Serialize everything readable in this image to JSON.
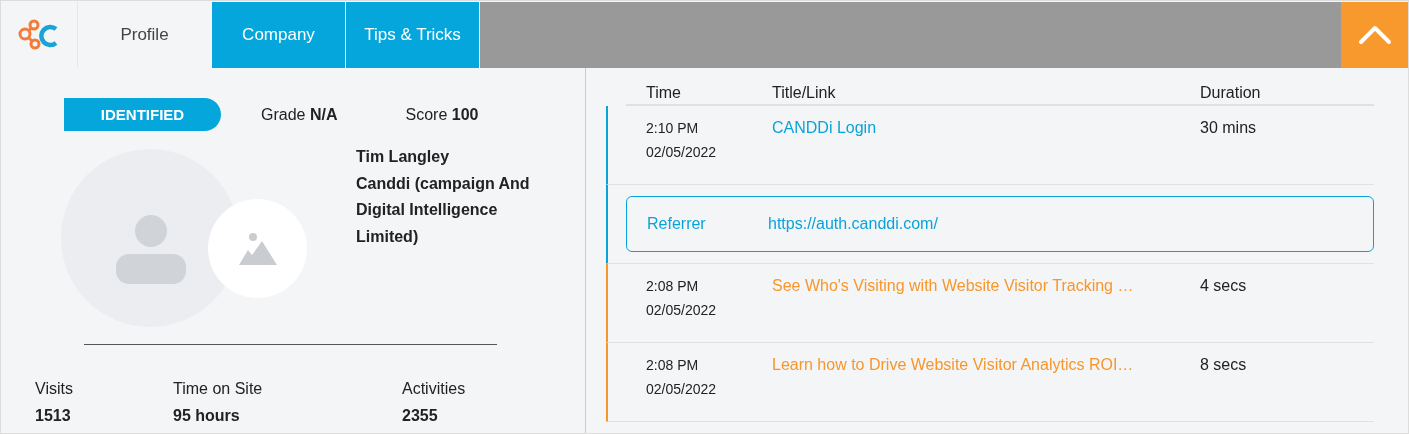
{
  "tabs": [
    {
      "label": "Profile",
      "selected": true
    },
    {
      "label": "Company",
      "selected": false
    },
    {
      "label": "Tips & Tricks",
      "selected": false
    }
  ],
  "profile": {
    "status": "IDENTIFIED",
    "grade_label": "Grade",
    "grade": "N/A",
    "score_label": "Score",
    "score": "100",
    "name": "Tim Langley",
    "company": "Canddi (campaign And Digital Intelligence Limited)"
  },
  "stats": [
    {
      "label": "Visits",
      "value": "1513"
    },
    {
      "label": "Time on Site",
      "value": "95 hours"
    },
    {
      "label": "Activities",
      "value": "2355"
    }
  ],
  "activity": {
    "columns": [
      "Time",
      "Title/Link",
      "Duration"
    ],
    "rows": [
      {
        "kind": "visit",
        "time": "2:10 PM",
        "date": "02/05/2022",
        "title": "CANDDi Login",
        "duration": "30 mins",
        "color": "#0aa3d9"
      },
      {
        "kind": "referrer",
        "label": "Referrer",
        "url": "https://auth.canddi.com/",
        "color": "#0aa3d9"
      },
      {
        "kind": "visit",
        "time": "2:08 PM",
        "date": "02/05/2022",
        "title": "See Who's Visiting with Website Visitor Tracking …",
        "duration": "4 secs",
        "color": "#f7962b"
      },
      {
        "kind": "visit",
        "time": "2:08 PM",
        "date": "02/05/2022",
        "title": "Learn how to Drive Website Visitor Analytics ROI…",
        "duration": "8 secs",
        "color": "#f7962b"
      }
    ]
  }
}
